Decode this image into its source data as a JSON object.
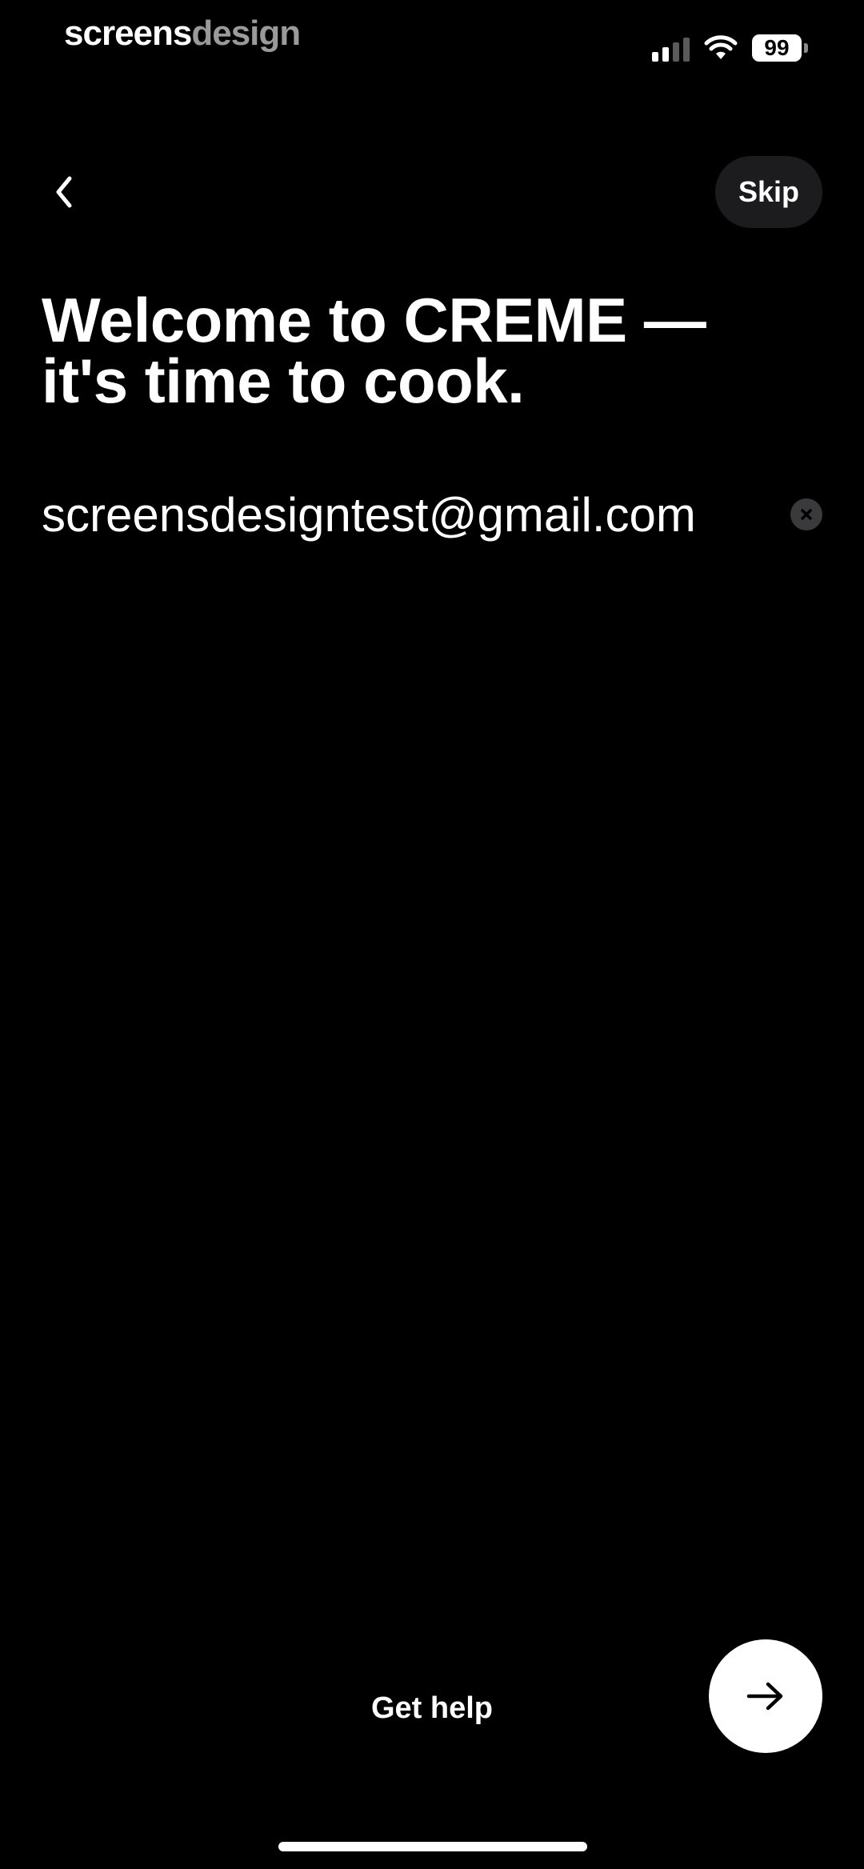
{
  "status_bar": {
    "brand_part1": "screens",
    "brand_part2": "design",
    "battery_level": "99",
    "signal_icon": "cellular-signal-icon",
    "wifi_icon": "wifi-icon"
  },
  "nav": {
    "back_icon": "chevron-left-icon",
    "skip_label": "Skip"
  },
  "main": {
    "title": "Welcome to CREME —\nit's time to cook.",
    "email_value": "screensdesigntest@gmail.com",
    "clear_icon": "clear-x-icon"
  },
  "footer": {
    "help_label": "Get help",
    "next_icon": "arrow-right-icon"
  },
  "colors": {
    "background": "#000000",
    "text": "#ffffff",
    "skip_bg": "#1c1c1e",
    "brand_secondary": "#9a9a9a"
  }
}
